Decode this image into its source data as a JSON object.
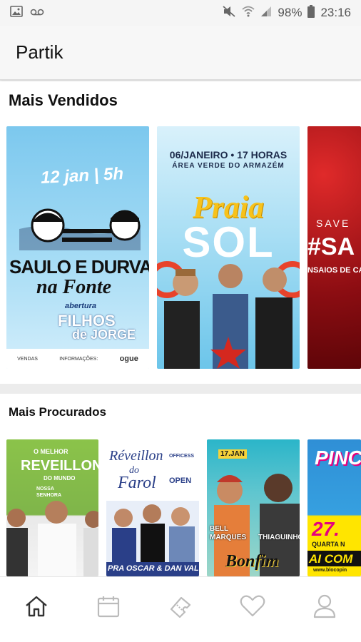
{
  "status_bar": {
    "battery": "98%",
    "time": "23:16",
    "icons": [
      "image-icon",
      "voicemail-icon",
      "mute-icon",
      "wifi-icon",
      "signal-icon",
      "battery-icon"
    ]
  },
  "app": {
    "title": "Partik"
  },
  "sections": [
    {
      "title": "Mais Vendidos",
      "events": [
        {
          "lines": [
            "12 jan | 5h",
            "SAULO E DURVAL",
            "na Fonte",
            "abertura",
            "FILHOS",
            "de JORGE"
          ],
          "footer": [
            "VENDAS",
            "INFORMAÇÕES:",
            "ogue"
          ]
        },
        {
          "lines": [
            "06/JANEIRO • 17 HORAS",
            "ÁREA VERDE DO ARMAZÉM",
            "Praia",
            "SOL"
          ]
        },
        {
          "lines": [
            "SAVE",
            "#SA",
            "NSAIOS DE CA"
          ]
        }
      ]
    },
    {
      "title": "Mais Procurados",
      "events": [
        {
          "lines": [
            "O MELHOR",
            "REVEILLON",
            "DO MUNDO",
            "NOSSA",
            "SENHORA"
          ]
        },
        {
          "lines": [
            "Réveillon",
            "do",
            "Farol",
            "OFFICESS",
            "OPEN",
            "PRA OSCAR & DAN VALEN"
          ]
        },
        {
          "lines": [
            "17.JAN",
            "BELL",
            "MARQUES",
            "THIAGUINHO",
            "Bonfim"
          ]
        },
        {
          "lines": [
            "PINC",
            "27.",
            "QUARTA N",
            "AI COM",
            "www.blocopin"
          ]
        }
      ]
    }
  ],
  "tab_bar": {
    "tabs": [
      "home-icon",
      "calendar-icon",
      "ticket-icon",
      "heart-icon",
      "profile-icon"
    ],
    "active_color": "#333333",
    "inactive_color": "#bbbbbb"
  }
}
